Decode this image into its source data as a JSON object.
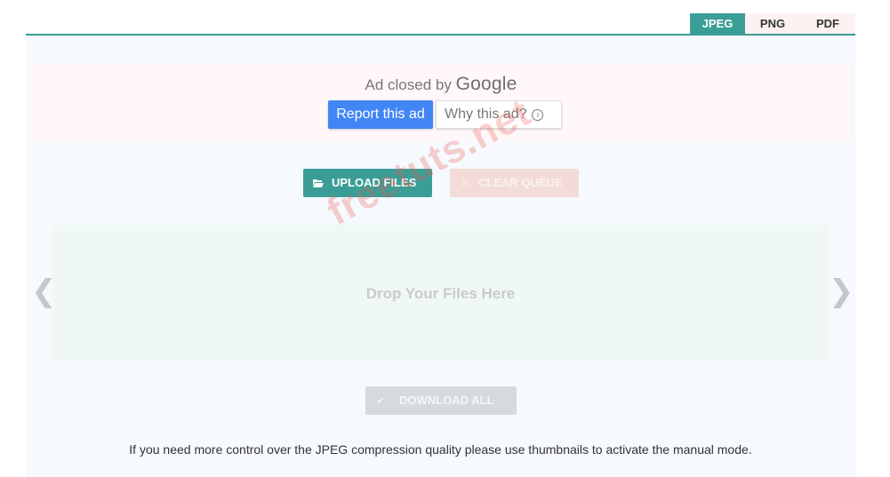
{
  "tabs": [
    {
      "label": "JPEG",
      "active": true
    },
    {
      "label": "PNG",
      "active": false
    },
    {
      "label": "PDF",
      "active": false
    }
  ],
  "ad": {
    "closed_text": "Ad closed by",
    "brand": "Google",
    "report_label": "Report this ad",
    "why_label": "Why this ad?"
  },
  "actions": {
    "upload_label": "UPLOAD FILES",
    "clear_label": "CLEAR QUEUE",
    "download_label": "DOWNLOAD ALL"
  },
  "dropzone": {
    "text": "Drop Your Files Here"
  },
  "icons": {
    "upload": "folder-open-icon",
    "clear": "close-icon",
    "download": "checkmark-icon",
    "prev": "chevron-left-icon",
    "next": "chevron-right-icon",
    "info": "info-icon"
  },
  "watermark": "freetuts.net",
  "note": "If you need more control over the JPEG compression quality please use thumbnails to activate the manual mode.",
  "colors": {
    "accent": "#3a9e96",
    "ad_button": "#4286f5",
    "clear_disabled": "#f3dcd7",
    "download_disabled": "#d6dadd"
  }
}
